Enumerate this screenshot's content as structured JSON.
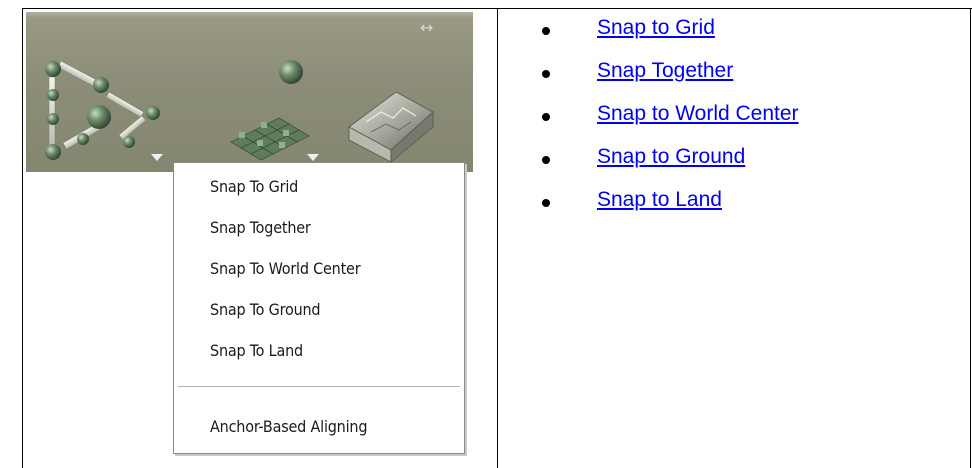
{
  "preview": {
    "double_arrow_glyph": "↔"
  },
  "menu": {
    "items": [
      {
        "label": "Snap To Grid"
      },
      {
        "label": "Snap Together"
      },
      {
        "label": "Snap To World Center"
      },
      {
        "label": "Snap To Ground"
      },
      {
        "label": "Snap To Land"
      }
    ],
    "footer_item": {
      "label": "Anchor-Based Aligning"
    }
  },
  "links": [
    {
      "label": "Snap to Grid"
    },
    {
      "label": "Snap Together"
    },
    {
      "label": "Snap to World Center"
    },
    {
      "label": "Snap to Ground"
    },
    {
      "label": "Snap to Land"
    }
  ],
  "colors": {
    "link": "#0000ee",
    "toolbar_bg": "#8c8d78",
    "object_green": "#6f8f6a"
  }
}
